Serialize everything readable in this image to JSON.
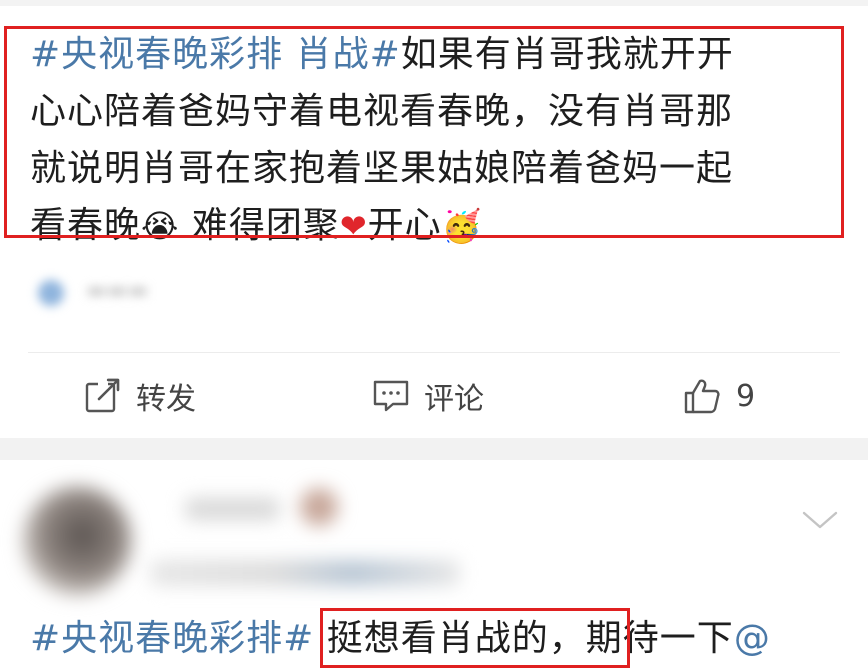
{
  "post": {
    "hashtag": "#央视春晚彩排 肖战#",
    "text_line1": "如果有肖哥我就开开",
    "text_line2": "心心陪着爸妈守着电视看春晚，没有肖哥那",
    "text_line3": "就说明肖哥在家抱着坚果姑娘陪着爸妈一起",
    "text_line4a": "看春晚",
    "text_line4b": " 难得团聚",
    "text_line4c": "开心",
    "emoji_joy": "😭",
    "emoji_heart": "❤",
    "emoji_party": "🥳"
  },
  "actions": {
    "repost_label": "转发",
    "comment_label": "评论",
    "like_count": "9"
  },
  "comment": {
    "hashtag": "#央视春晚彩排#",
    "text_highlight": " 挺想看肖战的，",
    "text_rest": "期待一下",
    "mention": "@"
  },
  "colors": {
    "hashtag": "#4a79a8",
    "highlight_box": "#e02020",
    "separator_band": "#f2f2f2"
  }
}
